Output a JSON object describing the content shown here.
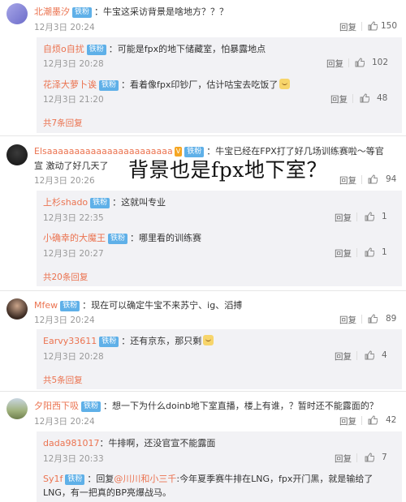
{
  "comments": [
    {
      "user": "北潮墨汐",
      "badge": "铁粉",
      "text": "牛宝这采访背景是啥地方？？？",
      "time": "12月3日 20:24",
      "reply": "回复",
      "likes": "150",
      "replies": [
        {
          "user": "自烦o自扰",
          "badge": "铁粉",
          "text": "可能是fpx的地下储藏室，怕暴露地点",
          "time": "12月3日 20:28",
          "reply": "回复",
          "likes": "102"
        },
        {
          "user": "花泽大萝卜诶",
          "badge": "铁粉",
          "text": "看着像fpx印钞厂，估计咕宝去吃饭了",
          "time": "12月3日 21:20",
          "reply": "回复",
          "likes": "48"
        }
      ],
      "more": "共7条回复"
    },
    {
      "user": "Elsaaaaaaaaaaaaaaaaaaaaaaa",
      "badge": "铁粉",
      "text": "牛宝已经在FPX打了好几场训练赛啦～等官宣 激动了好几天了",
      "time": "12月3日 20:26",
      "reply": "回复",
      "likes": "94",
      "replies": [
        {
          "user": "上杉shado",
          "badge": "铁粉",
          "text": "这就叫专业",
          "time": "12月3日 22:35",
          "reply": "回复",
          "likes": "1"
        },
        {
          "user": "小确幸的大魔王",
          "badge": "铁粉",
          "text": "哪里看的训练赛",
          "time": "12月3日 20:27",
          "reply": "回复",
          "likes": "1"
        }
      ],
      "more": "共20条回复"
    },
    {
      "user": "Mfew",
      "badge": "铁粉",
      "text": "现在可以确定牛宝不来苏宁、ig、滔搏",
      "time": "12月3日 20:24",
      "reply": "回复",
      "likes": "89",
      "replies": [
        {
          "user": "Earvy33611",
          "badge": "铁粉",
          "text": "还有京东，那只剩",
          "time": "12月3日 20:28",
          "reply": "回复",
          "likes": "4"
        }
      ],
      "more": "共5条回复"
    },
    {
      "user": "夕阳西下吸",
      "badge": "铁粉",
      "text": "想一下为什么doinb地下室直播，楼上有谁，？暂时还不能露面的？",
      "time": "12月3日 20:24",
      "reply": "回复",
      "likes": "42",
      "replies": [
        {
          "user": "dada981017",
          "badge": "",
          "text": "牛排啊，还没官宣不能露面",
          "time": "12月3日 20:33",
          "reply": "回复",
          "likes": "7"
        },
        {
          "user": "Sy1f",
          "badge": "铁粉",
          "text_prefix": "回复",
          "mention": "@川川和小三千",
          "text": ":今年夏季赛牛排在LNG，fpx开门黑，就是输给了LNG，有一把真的BP亮爆战马。",
          "time": "",
          "reply": "",
          "likes": ""
        }
      ],
      "more": ""
    }
  ],
  "overlay_text": "背景也是fpx地下室？",
  "colors": {
    "name": "#eb7350",
    "badge": "#5fb0e8",
    "subbg": "#f2f2f5"
  },
  "icons": {
    "thumb": "thumb-up-icon",
    "vip": "vip-badge-icon",
    "emoji": "smile-emoji-icon"
  }
}
